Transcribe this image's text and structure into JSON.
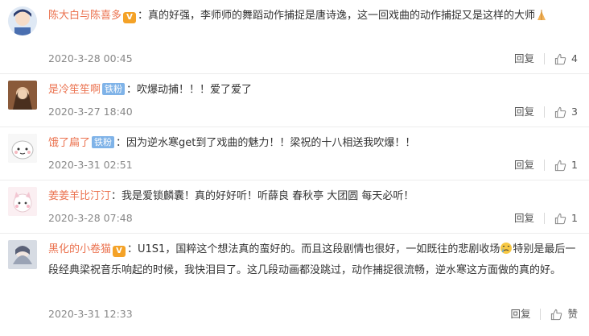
{
  "comments": [
    {
      "name": "陈大白与陈喜多",
      "badge": "",
      "vip": true,
      "text": "：真的好强，李师师的舞蹈动作捕捉是唐诗逸，这一回戏曲的动作捕捉又是这样的大师",
      "emoji_after": "hands",
      "time": "2020-3-28 00:45",
      "reply": "回复",
      "likes": "4"
    },
    {
      "name": "是冷笙笙啊",
      "badge": "铁粉",
      "vip": false,
      "text": "：吹爆动捕！！！爱了爱了",
      "time": "2020-3-27 18:40",
      "reply": "回复",
      "likes": "3"
    },
    {
      "name": "饿了扁了",
      "badge": "铁粉",
      "vip": false,
      "text": "：因为逆水寒get到了戏曲的魅力！！梁祝的十八相送我吹爆！！",
      "time": "2020-3-31 02:51",
      "reply": "回复",
      "likes": "1"
    },
    {
      "name": "姜姜羊比汀汀",
      "badge": "",
      "vip": false,
      "text": "：我是爱锁麟囊！真的好好听！听薛良 春秋亭 大团圆 每天必听！",
      "time": "2020-3-28 07:48",
      "reply": "回复",
      "likes": "1"
    },
    {
      "name": "黑化的小卷猫",
      "badge": "",
      "vip": true,
      "text_a": "：U1S1，国粹这个想法真的蛮好的。而且这段剧情也很好，一如既往的悲剧收场",
      "text_b": "特别是最后一段经典梁祝音乐响起的时候，我快泪目了。这几段动画都没跳过，动作捕捉很流畅，逆水寒这方面做的真的好。",
      "time": "2020-3-31 12:33",
      "reply": "回复",
      "likes": "赞"
    }
  ],
  "icons": {
    "like": "thumbs-up-icon",
    "vip": "vip-badge-icon"
  },
  "colors": {
    "name": "#eb7350",
    "badge": "#7fb3e8",
    "meta": "#888888"
  }
}
